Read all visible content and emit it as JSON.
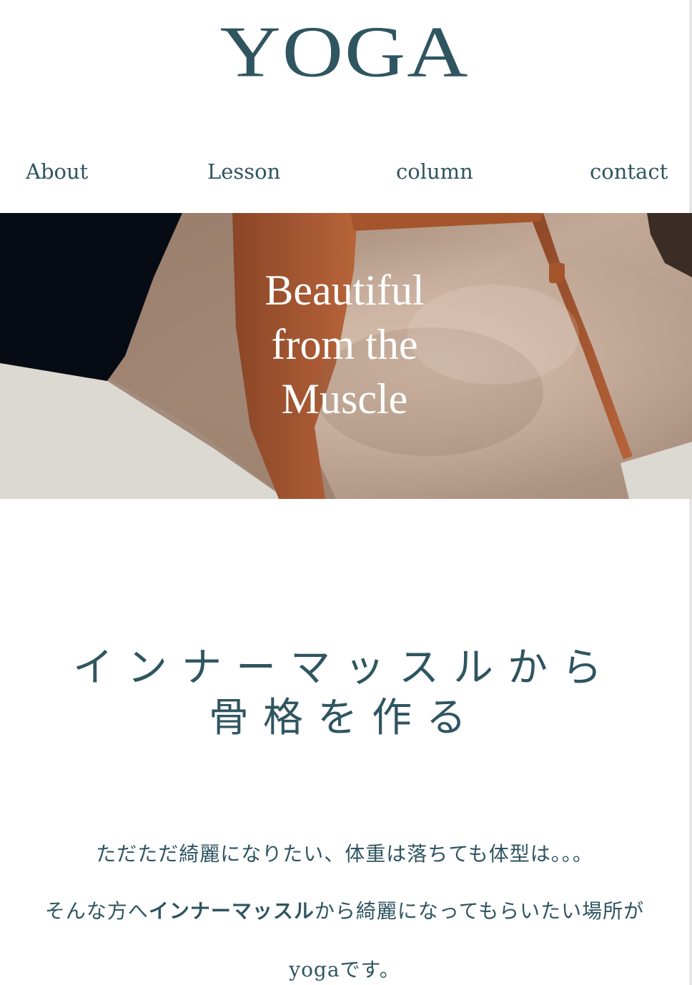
{
  "header": {
    "logo_text": "YOGA"
  },
  "nav": {
    "items": [
      {
        "label": "About"
      },
      {
        "label": "Lesson"
      },
      {
        "label": "column"
      },
      {
        "label": "contact"
      }
    ]
  },
  "hero": {
    "lines": [
      "Beautiful",
      "from the",
      "Muscle"
    ]
  },
  "intro": {
    "heading_lines": [
      "インナーマッスルから",
      "骨格を作る"
    ],
    "paragraph_line1": "ただただ綺麗になりたい、体重は落ちても体型は。。。",
    "paragraph_line2_before": "そんな方へ",
    "paragraph_line2_bold": "インナーマッスル",
    "paragraph_line2_after": "から綺麗になってもらいたい場所が",
    "paragraph_line3": "yogaです。"
  },
  "colors": {
    "brand": "#2f5560",
    "hero_skin": "#b49a86",
    "hero_strap": "#a4552c"
  }
}
